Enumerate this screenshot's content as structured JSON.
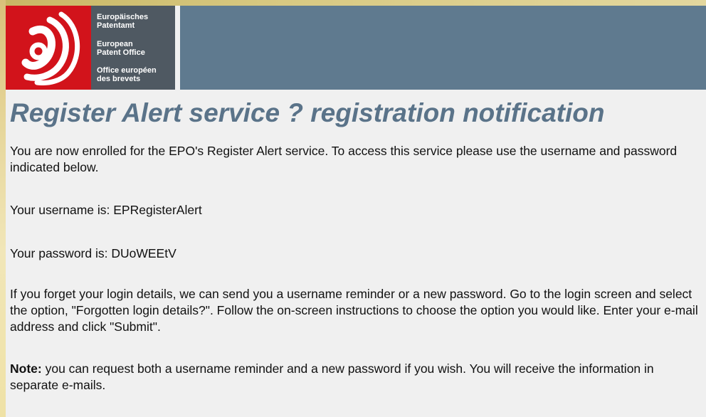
{
  "logo": {
    "line1a": "Europäisches",
    "line1b": "Patentamt",
    "line2a": "European",
    "line2b": "Patent Office",
    "line3a": "Office européen",
    "line3b": "des brevets"
  },
  "page": {
    "title": "Register Alert service ? registration notification",
    "intro": "You are now enrolled for the EPO's Register Alert service. To access this service please use the username and password indicated below.",
    "username_line": "Your username is: EPRegisterAlert",
    "password_line": "Your password is: DUoWEEtV",
    "forgot_text": "If you forget your login details, we can send you a username reminder or a new password. Go to the login screen and select the option, \"Forgotten login details?\". Follow the on-screen instructions to choose the option you would like. Enter your e-mail address and click \"Submit\".",
    "note_label": "Note:",
    "note_text": " you can request both a username reminder and a new password if you wish. You will receive the information in separate e-mails."
  },
  "colors": {
    "header_bar": "#5f7a8f",
    "logo_red": "#d2131b",
    "logo_gray": "#4f5962",
    "title": "#5a7389"
  }
}
